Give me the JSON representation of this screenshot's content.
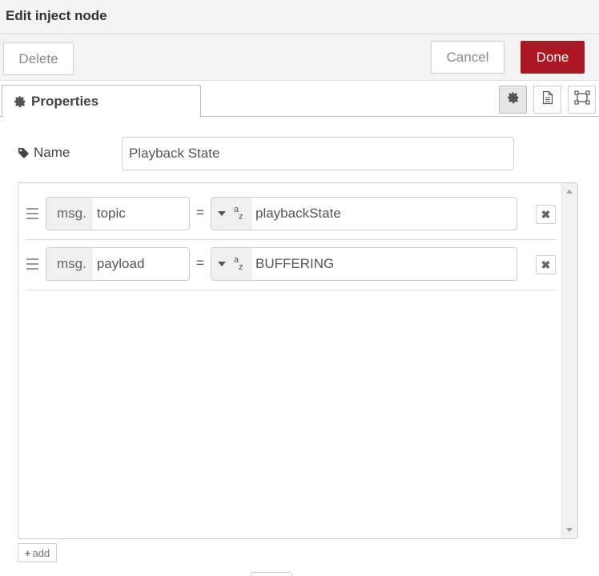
{
  "header": {
    "title": "Edit inject node"
  },
  "toolbar": {
    "delete_label": "Delete",
    "cancel_label": "Cancel",
    "done_label": "Done"
  },
  "tabs": {
    "properties_label": "Properties"
  },
  "tab_icons": [
    "gear-icon",
    "document-icon",
    "layout-icon"
  ],
  "form": {
    "name_label": "Name",
    "name_value": "Playback State"
  },
  "properties": [
    {
      "prefix": "msg.",
      "property": "topic",
      "operator": "=",
      "type_icon": "string-type-icon",
      "value": "playbackState"
    },
    {
      "prefix": "msg.",
      "property": "payload",
      "operator": "=",
      "type_icon": "string-type-icon",
      "value": "BUFFERING"
    }
  ],
  "list": {
    "add_label": "add"
  },
  "colors": {
    "done_button": "#ad1625",
    "header_bg": "#f3f3f3"
  }
}
